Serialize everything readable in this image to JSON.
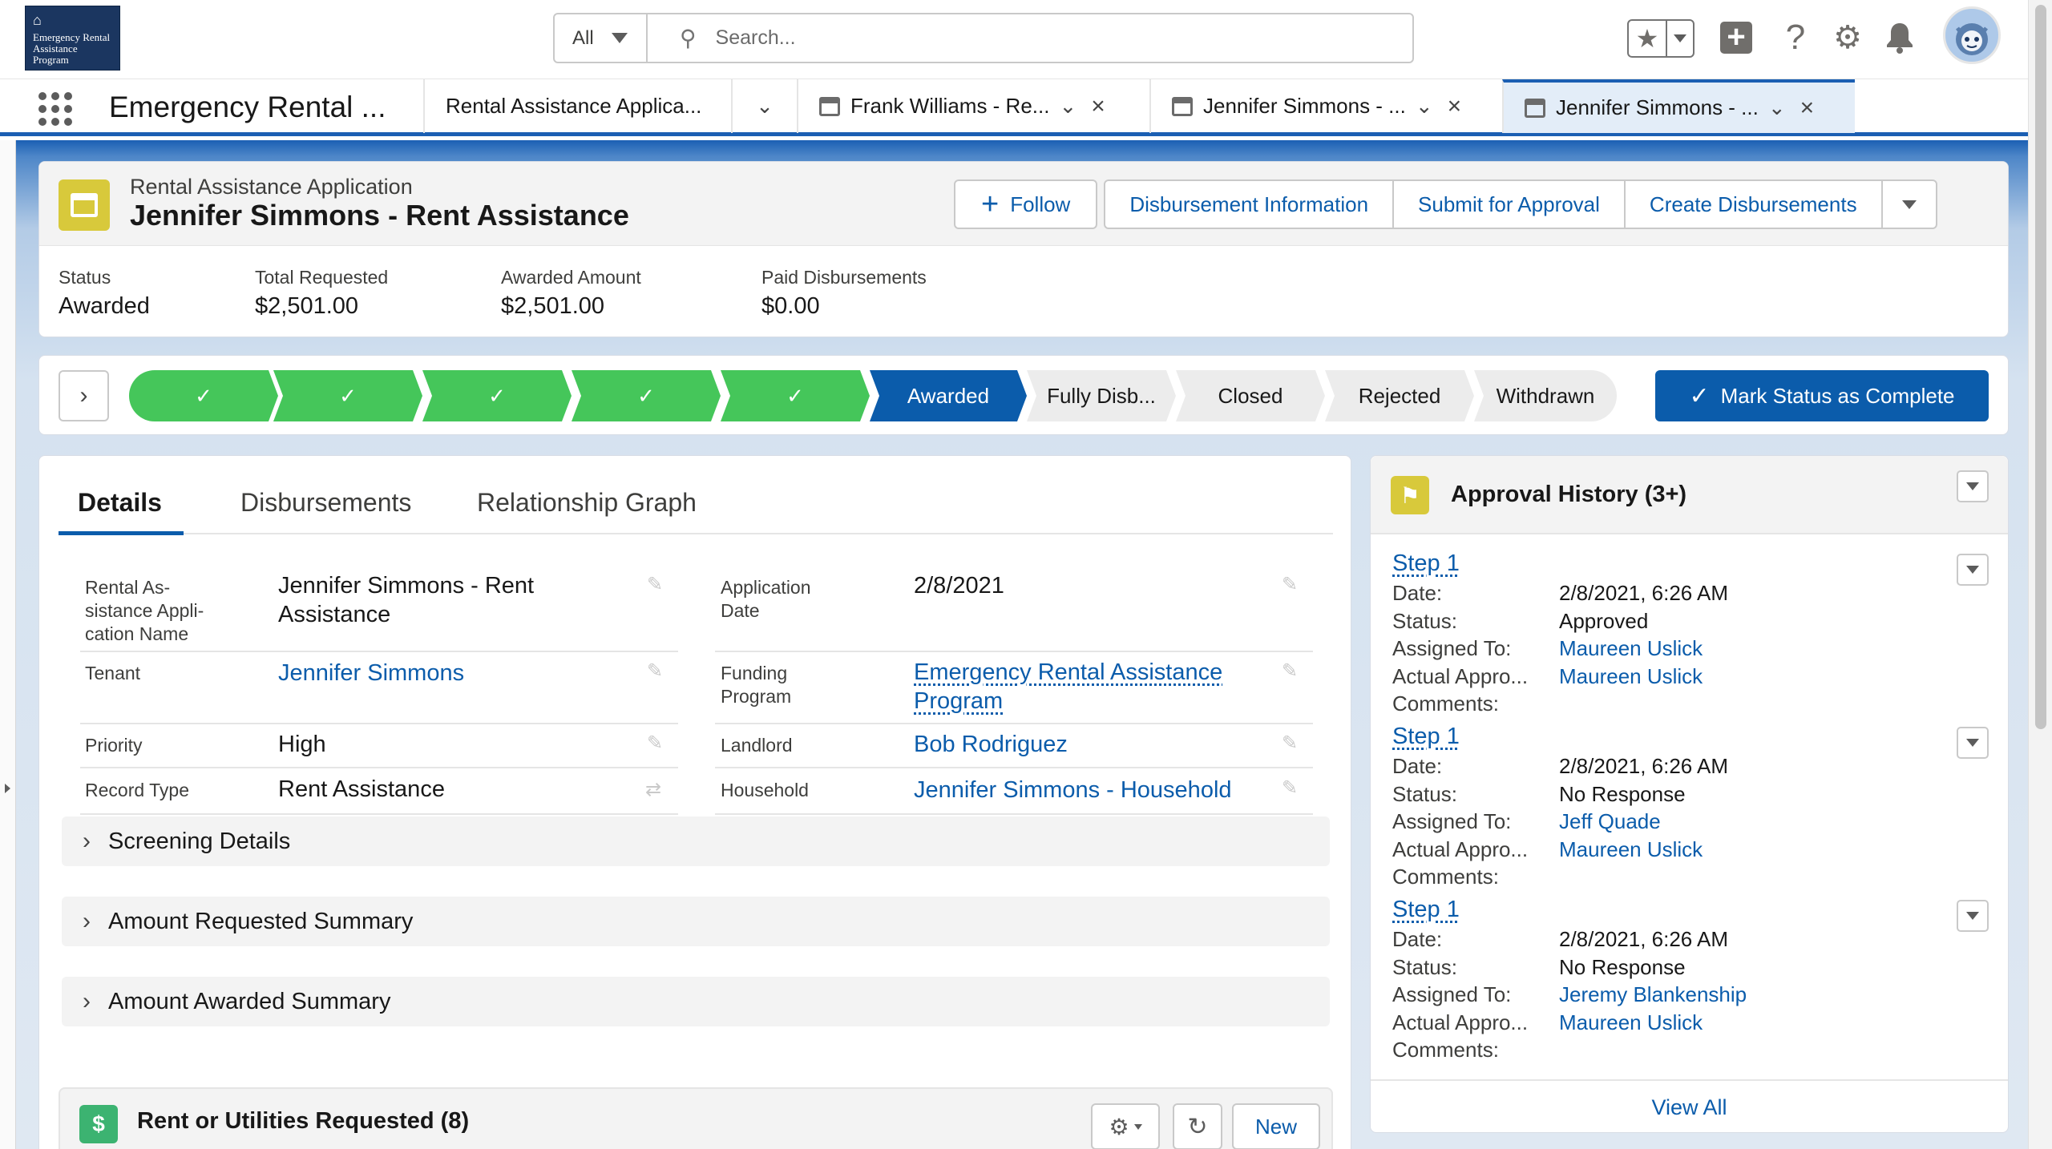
{
  "logo": {
    "text": "Emergency Rental Assistance Program"
  },
  "search": {
    "scope": "All",
    "placeholder": "Search..."
  },
  "header_icons": [
    "favorites-star-icon",
    "add-icon",
    "help-icon",
    "setup-gear-icon",
    "notifications-bell-icon",
    "user-avatar"
  ],
  "nav": {
    "app_name": "Emergency Rental ...",
    "tabs": [
      {
        "label": "Rental Assistance Applica...",
        "active": false
      },
      {
        "label": "Frank Williams - Re...",
        "active": false
      },
      {
        "label": "Jennifer Simmons - ...",
        "active": false
      },
      {
        "label": "Jennifer Simmons - ...",
        "active": true
      }
    ]
  },
  "record": {
    "type": "Rental Assistance Application",
    "name": "Jennifer Simmons - Rent Assistance",
    "actions": {
      "follow": "Follow",
      "disbursement_info": "Disbursement Information",
      "submit": "Submit for Approval",
      "create_disbursements": "Create Disbursements"
    },
    "highlights": [
      {
        "label": "Status",
        "value": "Awarded"
      },
      {
        "label": "Total Requested",
        "value": "$2,501.00"
      },
      {
        "label": "Awarded Amount",
        "value": "$2,501.00"
      },
      {
        "label": "Paid Disbursements",
        "value": "$0.00"
      }
    ]
  },
  "path": {
    "stages": [
      {
        "label": "✓",
        "state": "done"
      },
      {
        "label": "✓",
        "state": "done"
      },
      {
        "label": "✓",
        "state": "done"
      },
      {
        "label": "✓",
        "state": "done"
      },
      {
        "label": "✓",
        "state": "done"
      },
      {
        "label": "Awarded",
        "state": "current"
      },
      {
        "label": "Fully Disb...",
        "state": "todo"
      },
      {
        "label": "Closed",
        "state": "todo"
      },
      {
        "label": "Rejected",
        "state": "todo"
      },
      {
        "label": "Withdrawn",
        "state": "todo"
      }
    ],
    "mark_complete": "Mark Status as Complete"
  },
  "details": {
    "tabs": [
      "Details",
      "Disbursements",
      "Relationship Graph"
    ],
    "fields": {
      "name_label_1": "Rental As-",
      "name_label_2": "sistance Appli-",
      "name_label_3": "cation Name",
      "name_value_1": "Jennifer Simmons - Rent",
      "name_value_2": "Assistance",
      "app_date_label_1": "Application",
      "app_date_label_2": "Date",
      "app_date_value": "2/8/2021",
      "tenant_label": "Tenant",
      "tenant_value": "Jennifer Simmons",
      "funding_label_1": "Funding",
      "funding_label_2": "Program",
      "funding_value_1": "Emergency Rental Assistance",
      "funding_value_2": "Program",
      "priority_label": "Priority",
      "priority_value": "High",
      "landlord_label": "Landlord",
      "landlord_value": "Bob Rodriguez",
      "record_type_label": "Record Type",
      "record_type_value": "Rent Assistance",
      "household_label": "Household",
      "household_value": "Jennifer Simmons - Household"
    },
    "sections": [
      "Screening Details",
      "Amount Requested Summary",
      "Amount Awarded Summary"
    ],
    "related": {
      "title": "Rent or Utilities Requested (8)",
      "new_label": "New"
    }
  },
  "approval": {
    "title": "Approval History (3+)",
    "labels": {
      "date": "Date:",
      "status": "Status:",
      "assigned": "Assigned To:",
      "actual": "Actual Appro...",
      "comments": "Comments:"
    },
    "steps": [
      {
        "title": "Step 1",
        "date": "2/8/2021, 6:26 AM",
        "status": "Approved",
        "assigned": "Maureen Uslick",
        "actual": "Maureen Uslick",
        "comments": ""
      },
      {
        "title": "Step 1",
        "date": "2/8/2021, 6:26 AM",
        "status": "No Response",
        "assigned": "Jeff Quade",
        "actual": "Maureen Uslick",
        "comments": ""
      },
      {
        "title": "Step 1",
        "date": "2/8/2021, 6:26 AM",
        "status": "No Response",
        "assigned": "Jeremy Blankenship",
        "actual": "Maureen Uslick",
        "comments": ""
      }
    ],
    "view_all": "View All"
  },
  "colors": {
    "brand": "#0b5cab",
    "path_done": "#45c65a",
    "record_icon": "#d8c93b"
  }
}
